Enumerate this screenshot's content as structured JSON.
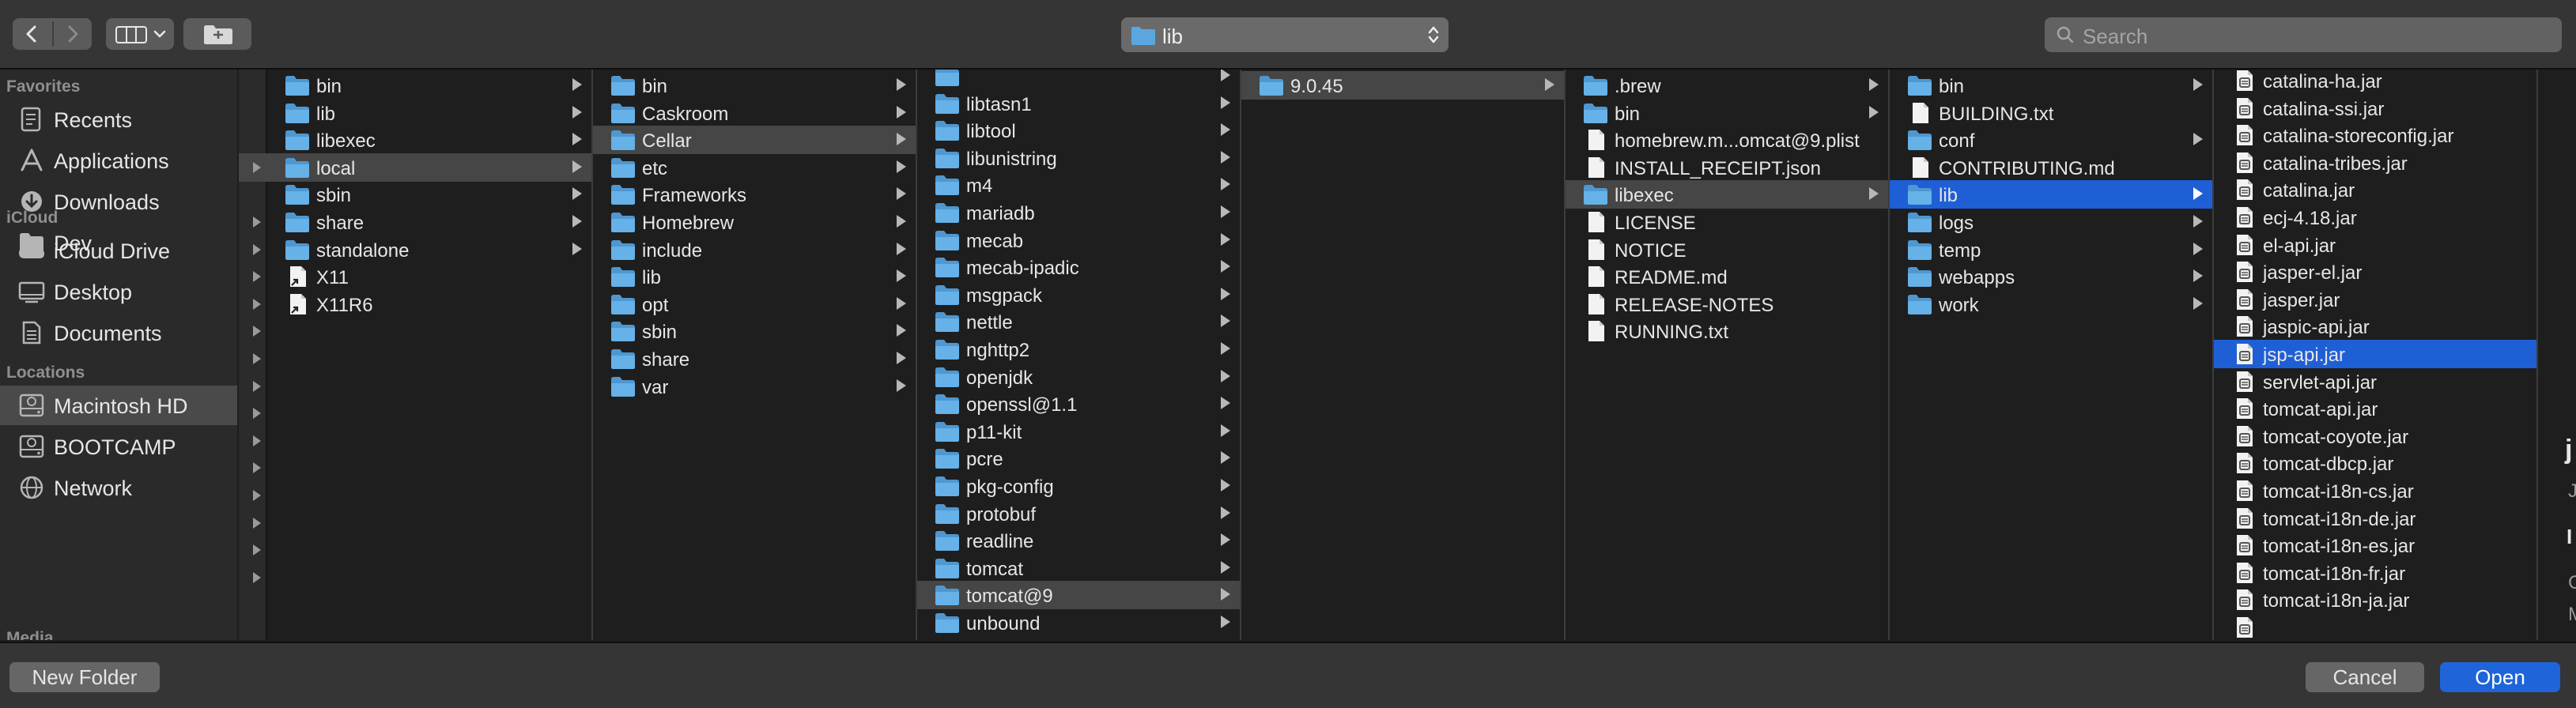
{
  "toolbar": {
    "back_icon": "chevron-left-icon",
    "forward_icon": "chevron-right-icon",
    "view_icon": "column-view-icon",
    "new_folder_icon": "new-folder-icon",
    "path_popup": {
      "current": "lib",
      "icon": "folder-icon"
    },
    "search": {
      "placeholder": "Search"
    }
  },
  "sidebar": {
    "favorites_header": "Favorites",
    "favorites": [
      {
        "label": "Recents",
        "icon": "recents-icon"
      },
      {
        "label": "Applications",
        "icon": "applications-icon"
      },
      {
        "label": "Downloads",
        "icon": "downloads-icon"
      },
      {
        "label": "Dev",
        "icon": "folder-icon"
      }
    ],
    "icloud_header": "iCloud",
    "icloud": [
      {
        "label": "iCloud Drive",
        "icon": "cloud-icon"
      },
      {
        "label": "Desktop",
        "icon": "desktop-icon"
      },
      {
        "label": "Documents",
        "icon": "document-icon"
      }
    ],
    "locations_header": "Locations",
    "locations": [
      {
        "label": "Macintosh HD",
        "icon": "hard-drive-icon",
        "selected": true
      },
      {
        "label": "BOOTCAMP",
        "icon": "hard-drive-icon"
      },
      {
        "label": "Network",
        "icon": "globe-icon"
      }
    ],
    "media_header": "Media"
  },
  "columns": [
    {
      "id": "col1",
      "items": [
        {
          "name": "bin",
          "type": "folder",
          "has_children": true
        },
        {
          "name": "lib",
          "type": "folder",
          "has_children": true
        },
        {
          "name": "libexec",
          "type": "folder",
          "has_children": true
        },
        {
          "name": "local",
          "type": "folder",
          "has_children": true,
          "selected": "dark"
        },
        {
          "name": "sbin",
          "type": "folder",
          "has_children": true
        },
        {
          "name": "share",
          "type": "folder",
          "has_children": true
        },
        {
          "name": "standalone",
          "type": "folder",
          "has_children": true
        },
        {
          "name": "X11",
          "type": "alias",
          "has_children": false
        },
        {
          "name": "X11R6",
          "type": "alias",
          "has_children": false
        }
      ]
    },
    {
      "id": "col2",
      "items": [
        {
          "name": "bin",
          "type": "folder",
          "has_children": true
        },
        {
          "name": "Caskroom",
          "type": "folder",
          "has_children": true
        },
        {
          "name": "Cellar",
          "type": "folder",
          "has_children": true,
          "selected": "dark"
        },
        {
          "name": "etc",
          "type": "folder",
          "has_children": true
        },
        {
          "name": "Frameworks",
          "type": "folder",
          "has_children": true
        },
        {
          "name": "Homebrew",
          "type": "folder",
          "has_children": true
        },
        {
          "name": "include",
          "type": "folder",
          "has_children": true
        },
        {
          "name": "lib",
          "type": "folder",
          "has_children": true
        },
        {
          "name": "opt",
          "type": "folder",
          "has_children": true
        },
        {
          "name": "sbin",
          "type": "folder",
          "has_children": true
        },
        {
          "name": "share",
          "type": "folder",
          "has_children": true
        },
        {
          "name": "var",
          "type": "folder",
          "has_children": true
        }
      ]
    },
    {
      "id": "col3",
      "items": [
        {
          "name": "",
          "type": "folder",
          "has_children": true,
          "partial": true
        },
        {
          "name": "libtasn1",
          "type": "folder",
          "has_children": true
        },
        {
          "name": "libtool",
          "type": "folder",
          "has_children": true
        },
        {
          "name": "libunistring",
          "type": "folder",
          "has_children": true
        },
        {
          "name": "m4",
          "type": "folder",
          "has_children": true
        },
        {
          "name": "mariadb",
          "type": "folder",
          "has_children": true
        },
        {
          "name": "mecab",
          "type": "folder",
          "has_children": true
        },
        {
          "name": "mecab-ipadic",
          "type": "folder",
          "has_children": true
        },
        {
          "name": "msgpack",
          "type": "folder",
          "has_children": true
        },
        {
          "name": "nettle",
          "type": "folder",
          "has_children": true
        },
        {
          "name": "nghttp2",
          "type": "folder",
          "has_children": true
        },
        {
          "name": "openjdk",
          "type": "folder",
          "has_children": true
        },
        {
          "name": "openssl@1.1",
          "type": "folder",
          "has_children": true
        },
        {
          "name": "p11-kit",
          "type": "folder",
          "has_children": true
        },
        {
          "name": "pcre",
          "type": "folder",
          "has_children": true
        },
        {
          "name": "pkg-config",
          "type": "folder",
          "has_children": true
        },
        {
          "name": "protobuf",
          "type": "folder",
          "has_children": true
        },
        {
          "name": "readline",
          "type": "folder",
          "has_children": true
        },
        {
          "name": "tomcat",
          "type": "folder",
          "has_children": true
        },
        {
          "name": "tomcat@9",
          "type": "folder",
          "has_children": true,
          "selected": "dark"
        },
        {
          "name": "unbound",
          "type": "folder",
          "has_children": true
        }
      ]
    },
    {
      "id": "col4",
      "items": [
        {
          "name": "9.0.45",
          "type": "folder",
          "has_children": true,
          "selected": "dark"
        }
      ]
    },
    {
      "id": "col5",
      "items": [
        {
          "name": ".brew",
          "type": "folder",
          "has_children": true
        },
        {
          "name": "bin",
          "type": "folder",
          "has_children": true
        },
        {
          "name": "homebrew.m...omcat@9.plist",
          "type": "file",
          "has_children": false
        },
        {
          "name": "INSTALL_RECEIPT.json",
          "type": "file",
          "has_children": false
        },
        {
          "name": "libexec",
          "type": "folder",
          "has_children": true,
          "selected": "dark"
        },
        {
          "name": "LICENSE",
          "type": "file",
          "has_children": false
        },
        {
          "name": "NOTICE",
          "type": "file",
          "has_children": false
        },
        {
          "name": "README.md",
          "type": "file",
          "has_children": false
        },
        {
          "name": "RELEASE-NOTES",
          "type": "file",
          "has_children": false
        },
        {
          "name": "RUNNING.txt",
          "type": "file",
          "has_children": false
        }
      ]
    },
    {
      "id": "col6",
      "items": [
        {
          "name": "bin",
          "type": "folder",
          "has_children": true
        },
        {
          "name": "BUILDING.txt",
          "type": "file",
          "has_children": false
        },
        {
          "name": "conf",
          "type": "folder",
          "has_children": true
        },
        {
          "name": "CONTRIBUTING.md",
          "type": "file",
          "has_children": false
        },
        {
          "name": "lib",
          "type": "folder",
          "has_children": true,
          "selected": "blue"
        },
        {
          "name": "logs",
          "type": "folder",
          "has_children": true
        },
        {
          "name": "temp",
          "type": "folder",
          "has_children": true
        },
        {
          "name": "webapps",
          "type": "folder",
          "has_children": true
        },
        {
          "name": "work",
          "type": "folder",
          "has_children": true
        }
      ]
    },
    {
      "id": "col7",
      "items": [
        {
          "name": "catalina-ha.jar",
          "type": "jar",
          "has_children": false
        },
        {
          "name": "catalina-ssi.jar",
          "type": "jar",
          "has_children": false
        },
        {
          "name": "catalina-storeconfig.jar",
          "type": "jar",
          "has_children": false
        },
        {
          "name": "catalina-tribes.jar",
          "type": "jar",
          "has_children": false
        },
        {
          "name": "catalina.jar",
          "type": "jar",
          "has_children": false
        },
        {
          "name": "ecj-4.18.jar",
          "type": "jar",
          "has_children": false
        },
        {
          "name": "el-api.jar",
          "type": "jar",
          "has_children": false
        },
        {
          "name": "jasper-el.jar",
          "type": "jar",
          "has_children": false
        },
        {
          "name": "jasper.jar",
          "type": "jar",
          "has_children": false
        },
        {
          "name": "jaspic-api.jar",
          "type": "jar",
          "has_children": false
        },
        {
          "name": "jsp-api.jar",
          "type": "jar",
          "has_children": false,
          "selected": "blue"
        },
        {
          "name": "servlet-api.jar",
          "type": "jar",
          "has_children": false
        },
        {
          "name": "tomcat-api.jar",
          "type": "jar",
          "has_children": false
        },
        {
          "name": "tomcat-coyote.jar",
          "type": "jar",
          "has_children": false
        },
        {
          "name": "tomcat-dbcp.jar",
          "type": "jar",
          "has_children": false
        },
        {
          "name": "tomcat-i18n-cs.jar",
          "type": "jar",
          "has_children": false
        },
        {
          "name": "tomcat-i18n-de.jar",
          "type": "jar",
          "has_children": false
        },
        {
          "name": "tomcat-i18n-es.jar",
          "type": "jar",
          "has_children": false
        },
        {
          "name": "tomcat-i18n-fr.jar",
          "type": "jar",
          "has_children": false
        },
        {
          "name": "tomcat-i18n-ja.jar",
          "type": "jar",
          "has_children": false
        },
        {
          "name": "",
          "type": "jar",
          "has_children": false,
          "partial": true
        }
      ]
    }
  ],
  "preview": {
    "title_start": "j",
    "line1_start": "J",
    "line2_start": "I",
    "line3_start": "C",
    "line4_start": "M"
  },
  "footer": {
    "new_folder_label": "New Folder",
    "cancel_label": "Cancel",
    "open_label": "Open"
  },
  "colors": {
    "selection_blue": "#1f5fd6",
    "selection_gray": "#464646",
    "folder_blue": "#5aa7e0"
  }
}
